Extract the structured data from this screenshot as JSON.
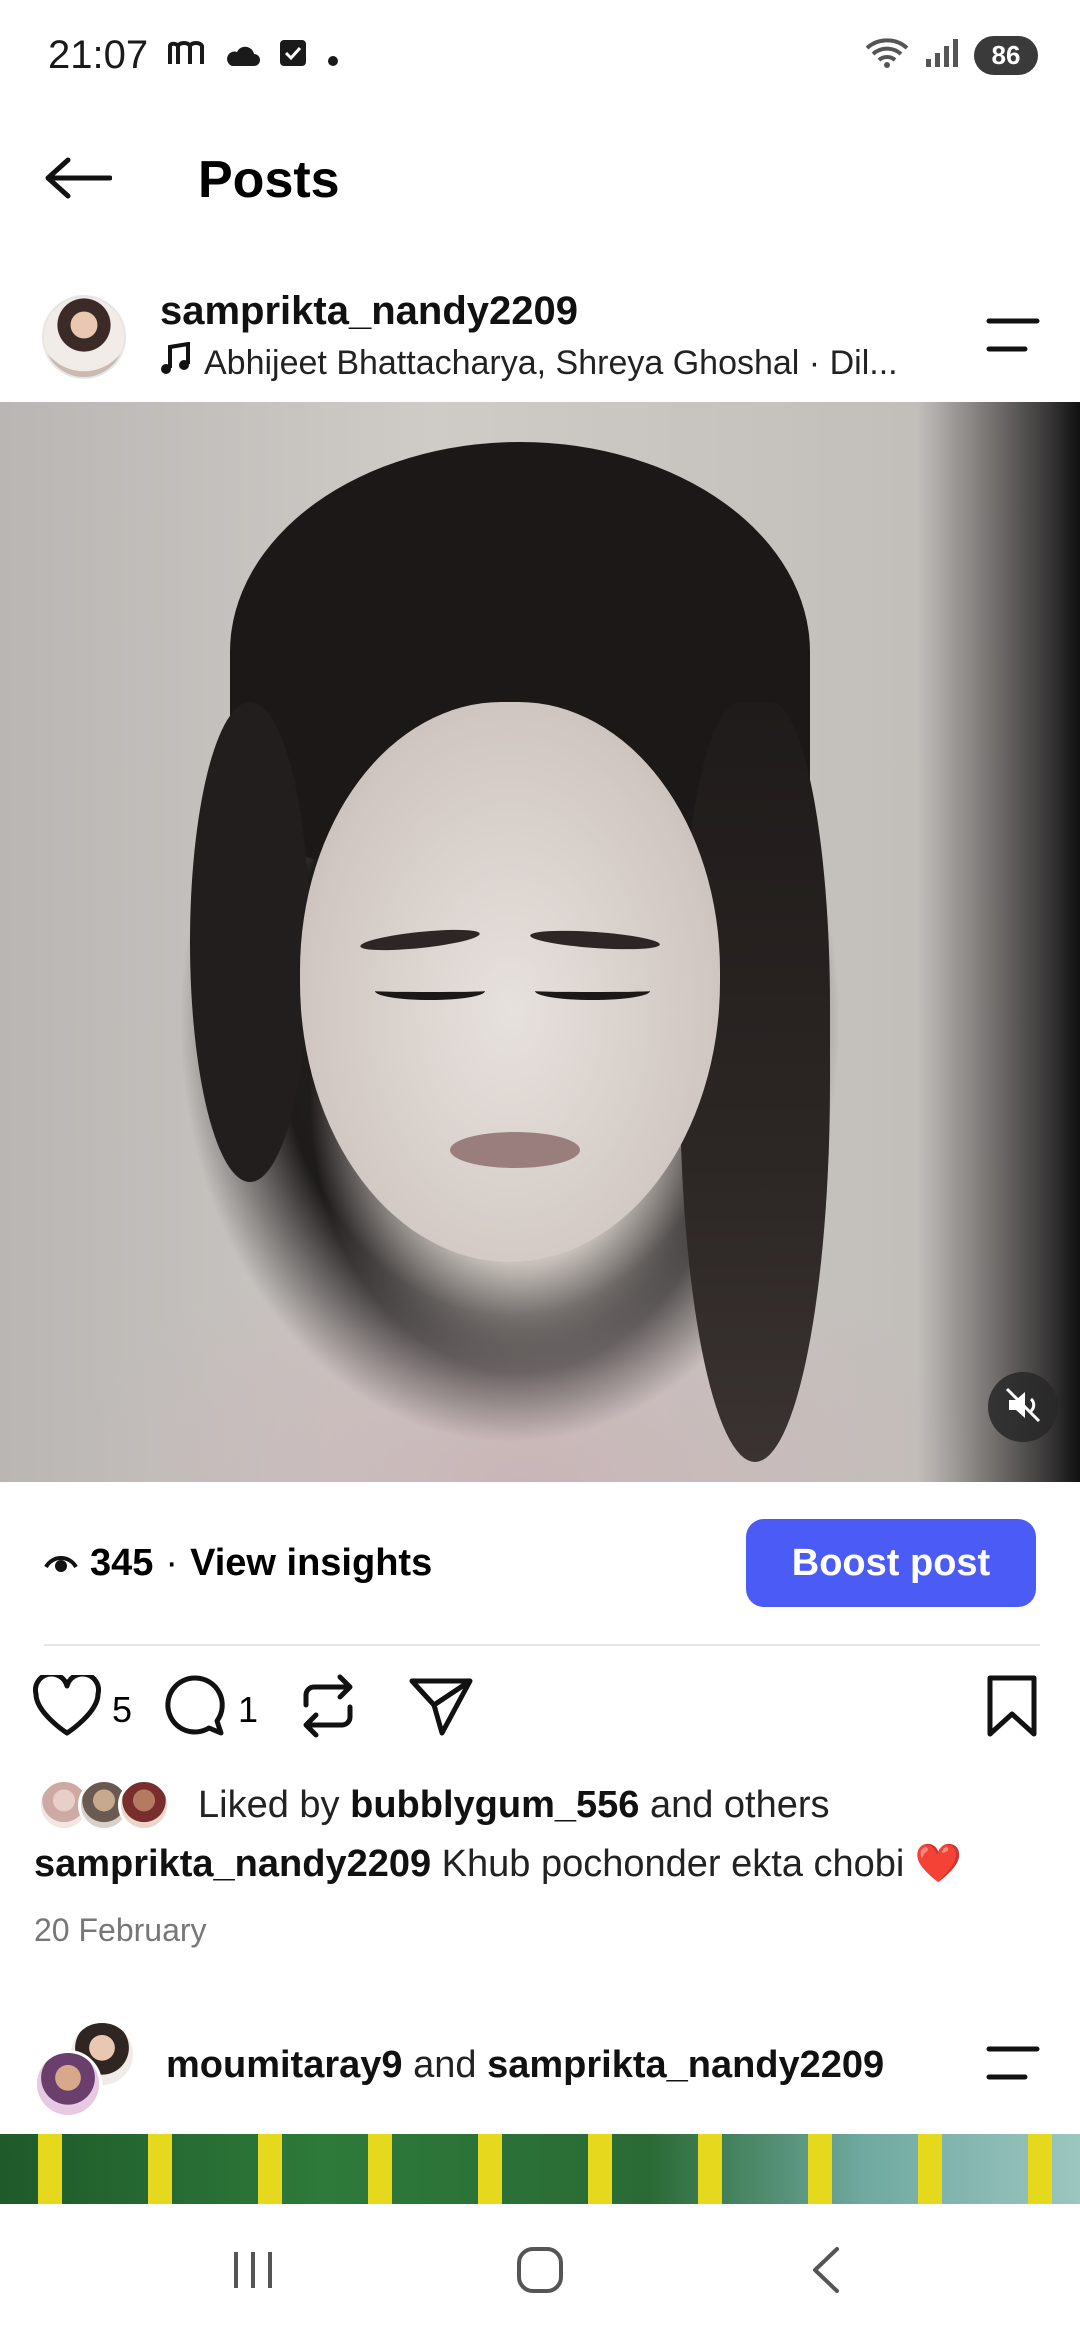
{
  "status_bar": {
    "time": "21:07",
    "battery": "86",
    "icons": [
      "m-app-icon",
      "cloud-icon",
      "checkbox-icon",
      "dot-icon",
      "wifi-icon",
      "signal-icon"
    ]
  },
  "header": {
    "title": "Posts",
    "back_icon": "back-arrow-icon"
  },
  "post": {
    "username": "samprikta_nandy2209",
    "audio": "Abhijeet Bhattacharya, Shreya Ghoshal · Dil...",
    "views": "345",
    "separator": "·",
    "view_insights": "View insights",
    "boost_label": "Boost post",
    "likes_count": "5",
    "comments_count": "1",
    "liked_by_prefix": "Liked by",
    "liked_by_user": "bubblygum_556",
    "liked_by_suffix": "and others",
    "caption_user": "samprikta_nandy2209",
    "caption_text": "Khub pochonder ekta chobi",
    "caption_emoji": "❤️",
    "date": "20 February"
  },
  "next_post": {
    "user_a": "moumitaray9",
    "joiner": "and",
    "user_b": "samprikta_nandy2209"
  },
  "colors": {
    "accent": "#4a5cf5",
    "text": "#111111",
    "muted": "#777777"
  }
}
